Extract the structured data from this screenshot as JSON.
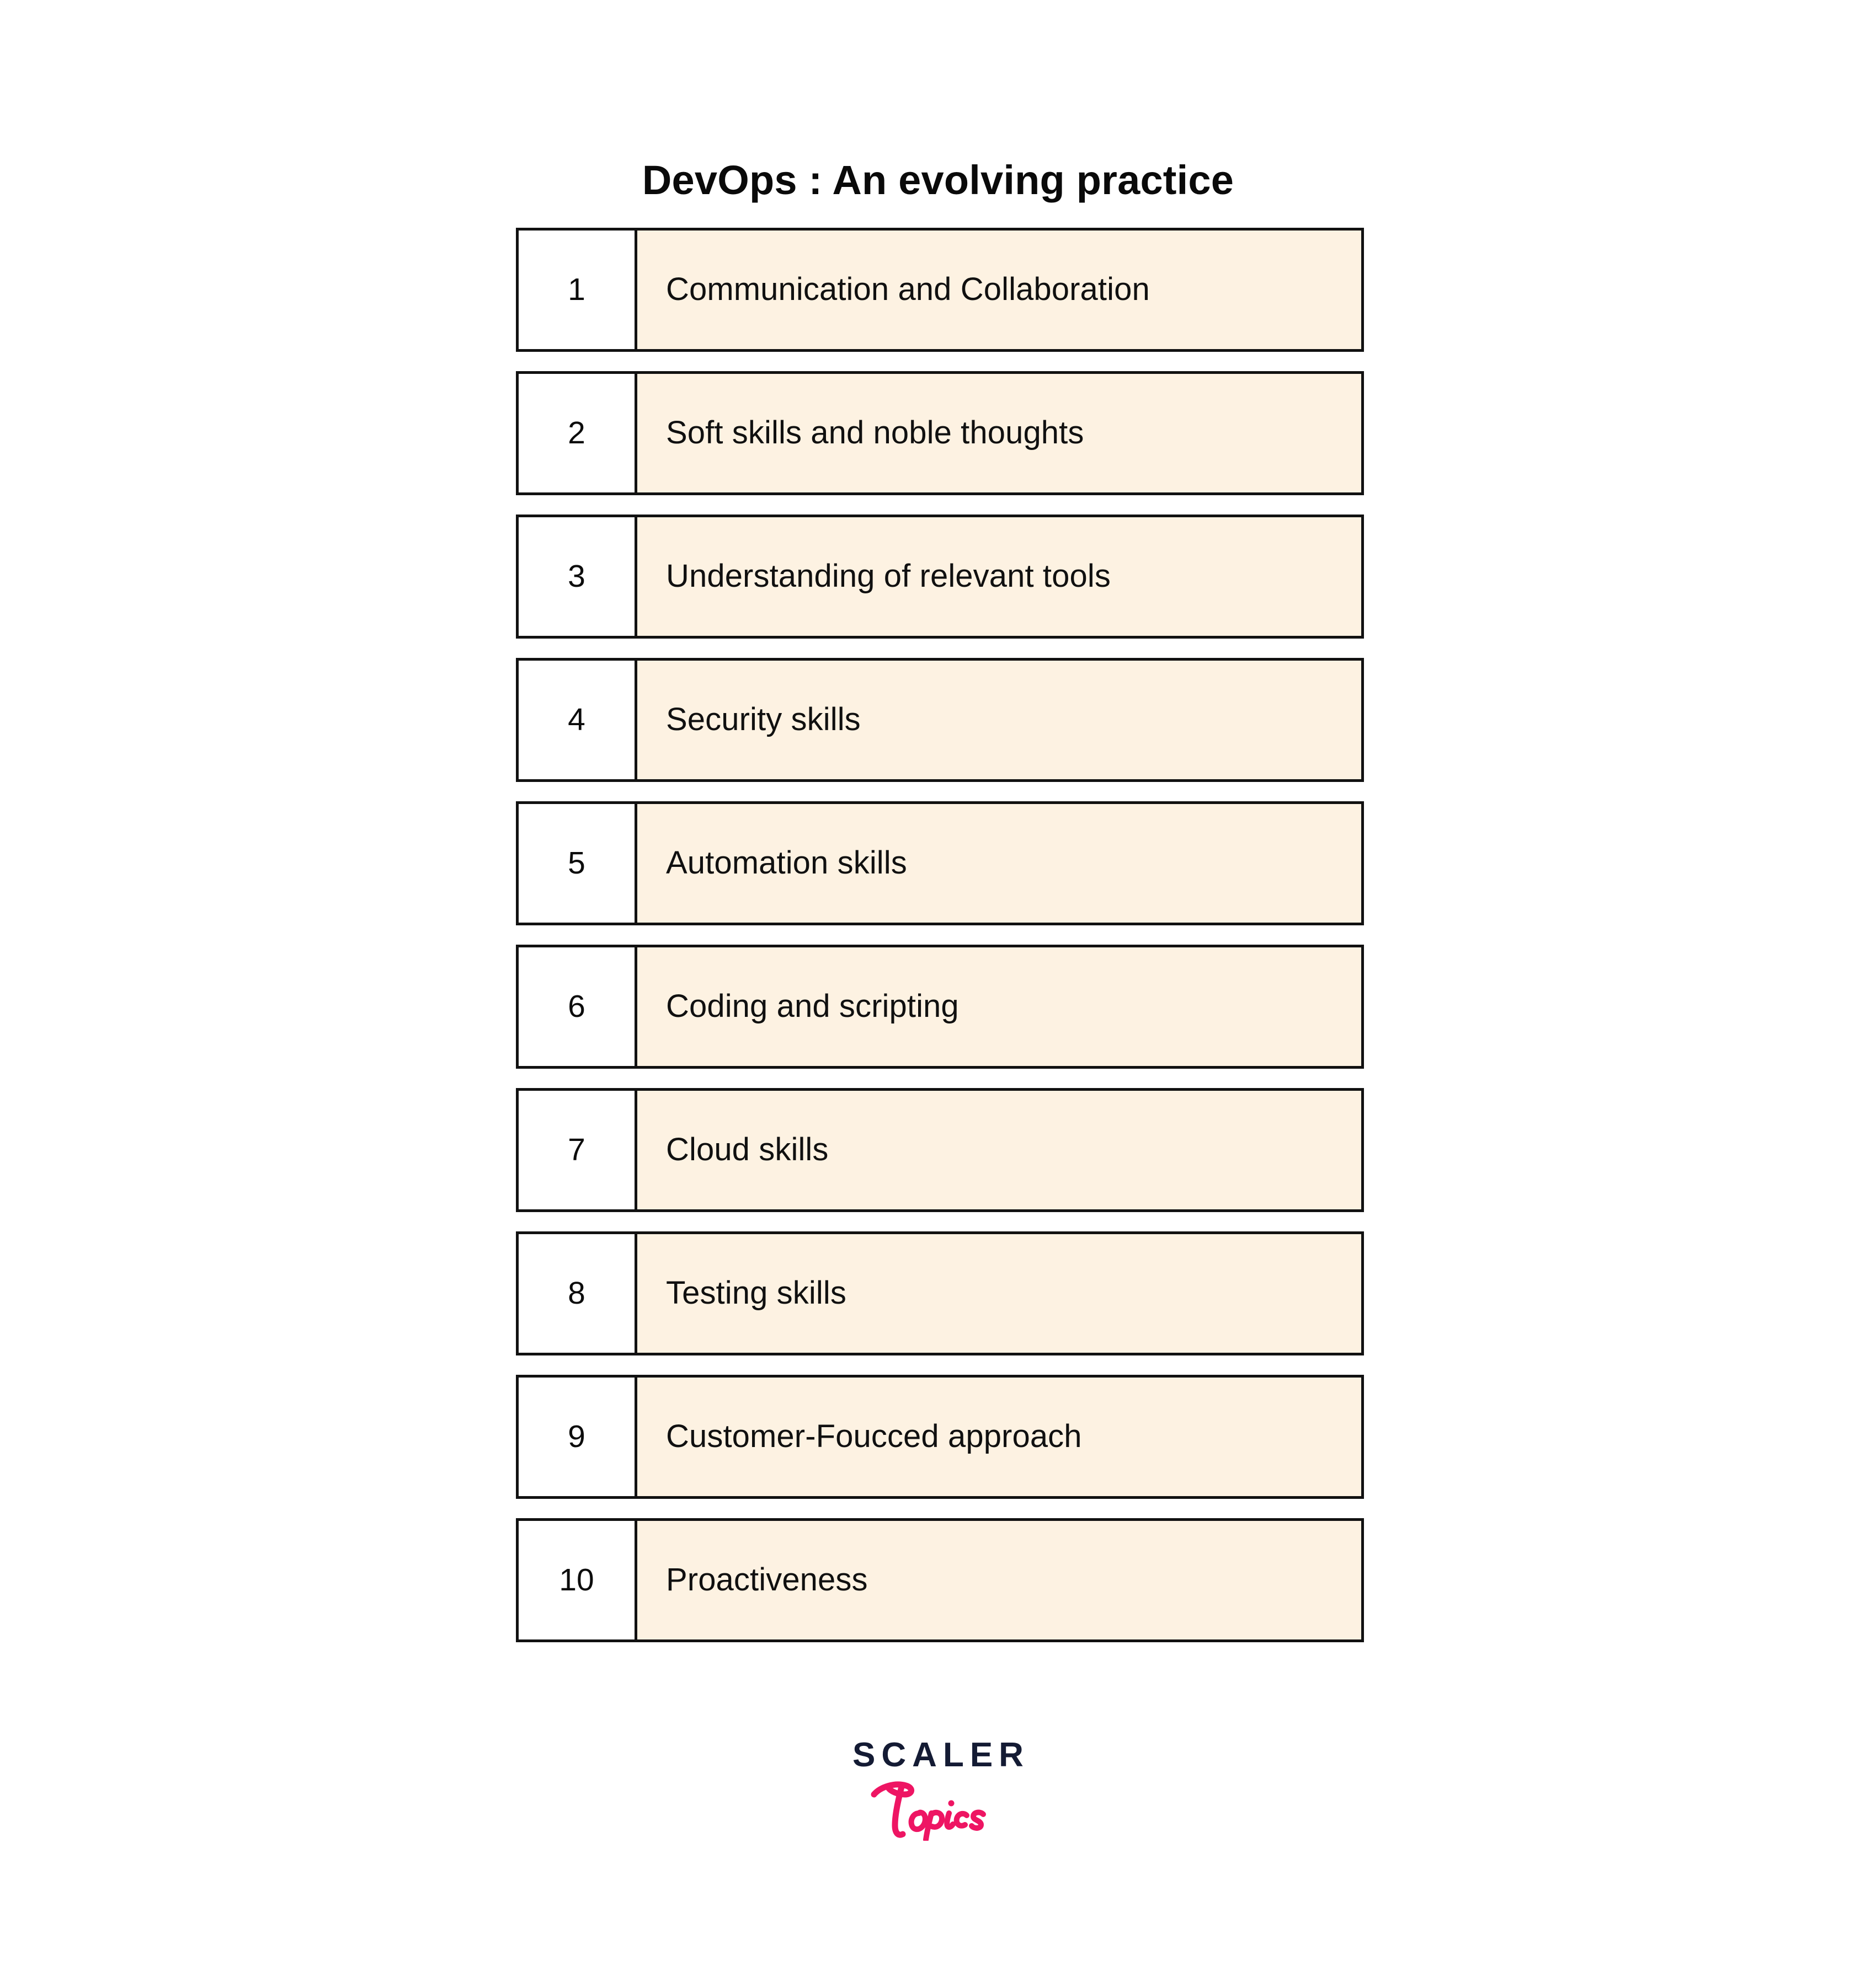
{
  "page": {
    "background_color": "#ffffff",
    "title": "DevOps : An evolving practice"
  },
  "table": {
    "number_column_header": "",
    "label_column_header": "",
    "cell_fill_color": "#fdf2e2",
    "border_color": "#111111",
    "rows": [
      {
        "number": "1",
        "label": "Communication and Collaboration"
      },
      {
        "number": "2",
        "label": "Soft skills and noble thoughts"
      },
      {
        "number": "3",
        "label": "Understanding of relevant tools"
      },
      {
        "number": "4",
        "label": "Security skills"
      },
      {
        "number": "5",
        "label": "Automation skills"
      },
      {
        "number": "6",
        "label": "Coding and scripting"
      },
      {
        "number": "7",
        "label": "Cloud skills"
      },
      {
        "number": "8",
        "label": "Testing skills"
      },
      {
        "number": "9",
        "label": "Customer-Foucced approach"
      },
      {
        "number": "10",
        "label": "Proactiveness"
      }
    ]
  },
  "logo": {
    "wordmark": "SCALER",
    "wordmark_color": "#141b34",
    "script": "Topics",
    "script_color": "#ee1563"
  }
}
